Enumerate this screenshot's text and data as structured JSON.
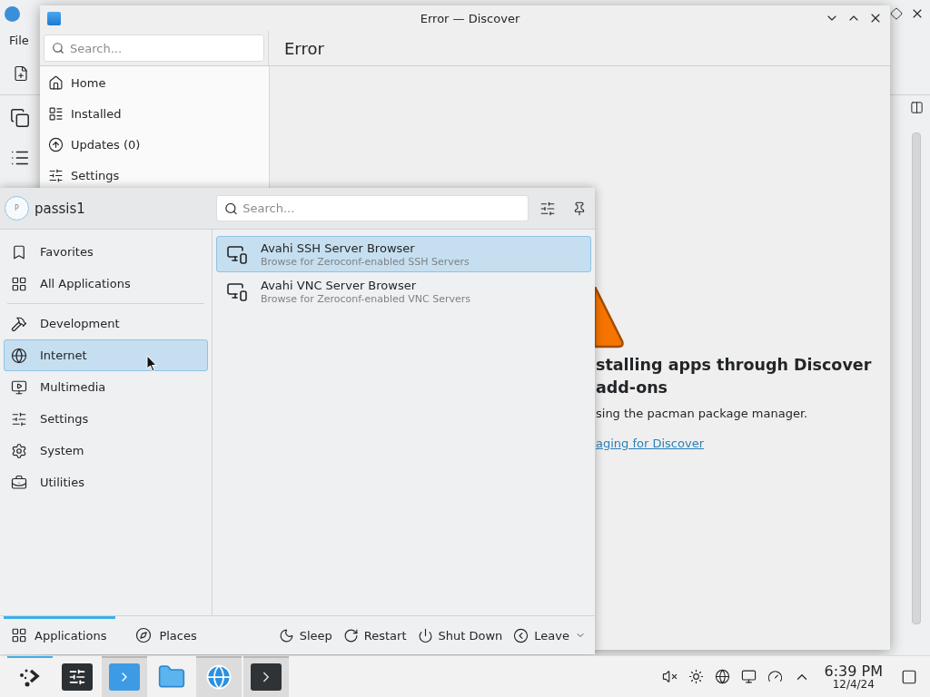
{
  "background_window": {
    "menu": [
      "File"
    ]
  },
  "discover": {
    "title": "Error — Discover",
    "search": {
      "placeholder": "Search..."
    },
    "page_title": "Error",
    "nav": [
      {
        "label": "Home",
        "selected": false
      },
      {
        "label": "Installed",
        "selected": false
      },
      {
        "label": "Updates (0)",
        "selected": false
      },
      {
        "label": "Settings",
        "selected": false
      }
    ],
    "message": {
      "heading_lines": [
        "stalling apps through Discover",
        "add-ons"
      ],
      "body": "sing the pacman package manager.",
      "link": "aging for Discover"
    }
  },
  "launcher": {
    "user": {
      "initial": "P",
      "name": "passis1"
    },
    "search": {
      "placeholder": "Search..."
    },
    "categories": [
      {
        "label": "Favorites",
        "selected": false
      },
      {
        "label": "All Applications",
        "selected": false
      },
      {
        "label": "Development",
        "selected": false
      },
      {
        "label": "Internet",
        "selected": true
      },
      {
        "label": "Multimedia",
        "selected": false
      },
      {
        "label": "Settings",
        "selected": false
      },
      {
        "label": "System",
        "selected": false
      },
      {
        "label": "Utilities",
        "selected": false
      }
    ],
    "apps": [
      {
        "name": "Avahi SSH Server Browser",
        "description": "Browse for Zeroconf-enabled SSH Servers",
        "selected": true
      },
      {
        "name": "Avahi VNC Server Browser",
        "description": "Browse for Zeroconf-enabled VNC Servers",
        "selected": false
      }
    ],
    "tabs": [
      {
        "label": "Applications",
        "selected": true
      },
      {
        "label": "Places",
        "selected": false
      }
    ],
    "actions": [
      "Sleep",
      "Restart",
      "Shut Down",
      "Leave"
    ]
  },
  "taskbar": {
    "tasks": [
      {
        "selected": true,
        "running": false
      },
      {
        "selected": false,
        "running": false
      },
      {
        "selected": false,
        "running": true
      },
      {
        "selected": false,
        "running": false
      },
      {
        "selected": false,
        "running": true
      },
      {
        "selected": false,
        "running": true
      }
    ],
    "clock": {
      "time": "6:39 PM",
      "date": "12/4/24"
    }
  }
}
